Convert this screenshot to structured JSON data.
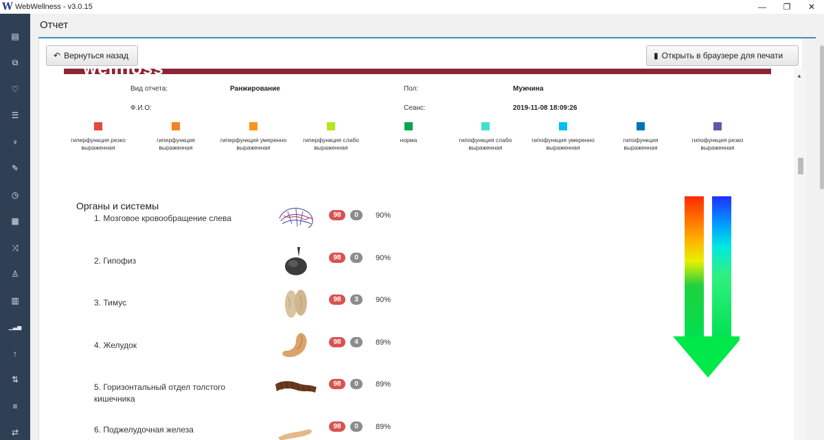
{
  "window": {
    "title": "WebWellness - v3.0.15",
    "logo_letter": "W",
    "minimize": "—",
    "restore": "❐",
    "close": "✕"
  },
  "sidebar": {
    "items": [
      {
        "icon": "newspaper-icon",
        "glyph": "▤"
      },
      {
        "icon": "copy-icon",
        "glyph": "⧉"
      },
      {
        "icon": "stethoscope-icon",
        "glyph": "♡"
      },
      {
        "icon": "sliders-icon",
        "glyph": "☰"
      },
      {
        "icon": "cutlery-icon",
        "glyph": "♆"
      },
      {
        "icon": "pencil-icon",
        "glyph": "✎"
      },
      {
        "icon": "clock-icon",
        "glyph": "◷"
      },
      {
        "icon": "calculator-icon",
        "glyph": "▦"
      },
      {
        "icon": "shuffle-icon",
        "glyph": "⤨"
      },
      {
        "icon": "person-icon",
        "glyph": "♙"
      },
      {
        "icon": "bar-chart-icon",
        "glyph": "▥"
      },
      {
        "icon": "signal-icon",
        "glyph": "▁▃▅"
      },
      {
        "icon": "arrow-up-icon",
        "glyph": "↑"
      },
      {
        "icon": "sort-icon",
        "glyph": "⇅"
      },
      {
        "icon": "server-icon",
        "glyph": "≡"
      },
      {
        "icon": "exchange-icon",
        "glyph": "⇄"
      }
    ]
  },
  "page": {
    "title": "Отчет",
    "back_button": "Вернуться назад",
    "print_button": "Открыть в браузере для печати"
  },
  "report": {
    "logo_fragment": "wellnoss",
    "report_type_label": "Вид отчета:",
    "report_type_value": "Ранжирование",
    "fio_label": "Ф.И.О:",
    "fio_value": "",
    "gender_label": "Пол:",
    "gender_value": "Мужчина",
    "session_label": "Сеанс:",
    "session_value": "2019-11-08 18:09:26"
  },
  "legend": [
    {
      "label": "гиперфункция резко выраженная",
      "color": "#e24a3b"
    },
    {
      "label": "гиперфункция выраженная",
      "color": "#f58220"
    },
    {
      "label": "гиперфункция умеренно выраженная",
      "color": "#f7941d"
    },
    {
      "label": "гиперфункция слабо выраженная",
      "color": "#b5e61d"
    },
    {
      "label": "норма",
      "color": "#00a651"
    },
    {
      "label": "гипофункция слабо выраженная",
      "color": "#40e0d0"
    },
    {
      "label": "гипофункция умеренно выраженная",
      "color": "#00bfef"
    },
    {
      "label": "гипофункция выраженная",
      "color": "#0072bc"
    },
    {
      "label": "гипофункция резко выраженная",
      "color": "#6357a8"
    }
  ],
  "section": {
    "title": "Органы и системы"
  },
  "organs": [
    {
      "name": "1. Мозговое кровообращение слева",
      "score": "98",
      "extra": "0",
      "percent": "90%",
      "image": "brain-vessels"
    },
    {
      "name": "2. Гипофиз",
      "score": "98",
      "extra": "0",
      "percent": "90%",
      "image": "pituitary"
    },
    {
      "name": "3. Тимус",
      "score": "98",
      "extra": "3",
      "percent": "90%",
      "image": "thymus"
    },
    {
      "name": "4. Желудок",
      "score": "98",
      "extra": "4",
      "percent": "89%",
      "image": "stomach"
    },
    {
      "name": "5. Горизонтальный отдел толстого кишечника",
      "score": "98",
      "extra": "0",
      "percent": "89%",
      "image": "colon"
    },
    {
      "name": "6. Поджелудочная железа",
      "score": "98",
      "extra": "0",
      "percent": "89%",
      "image": "pancreas"
    }
  ]
}
